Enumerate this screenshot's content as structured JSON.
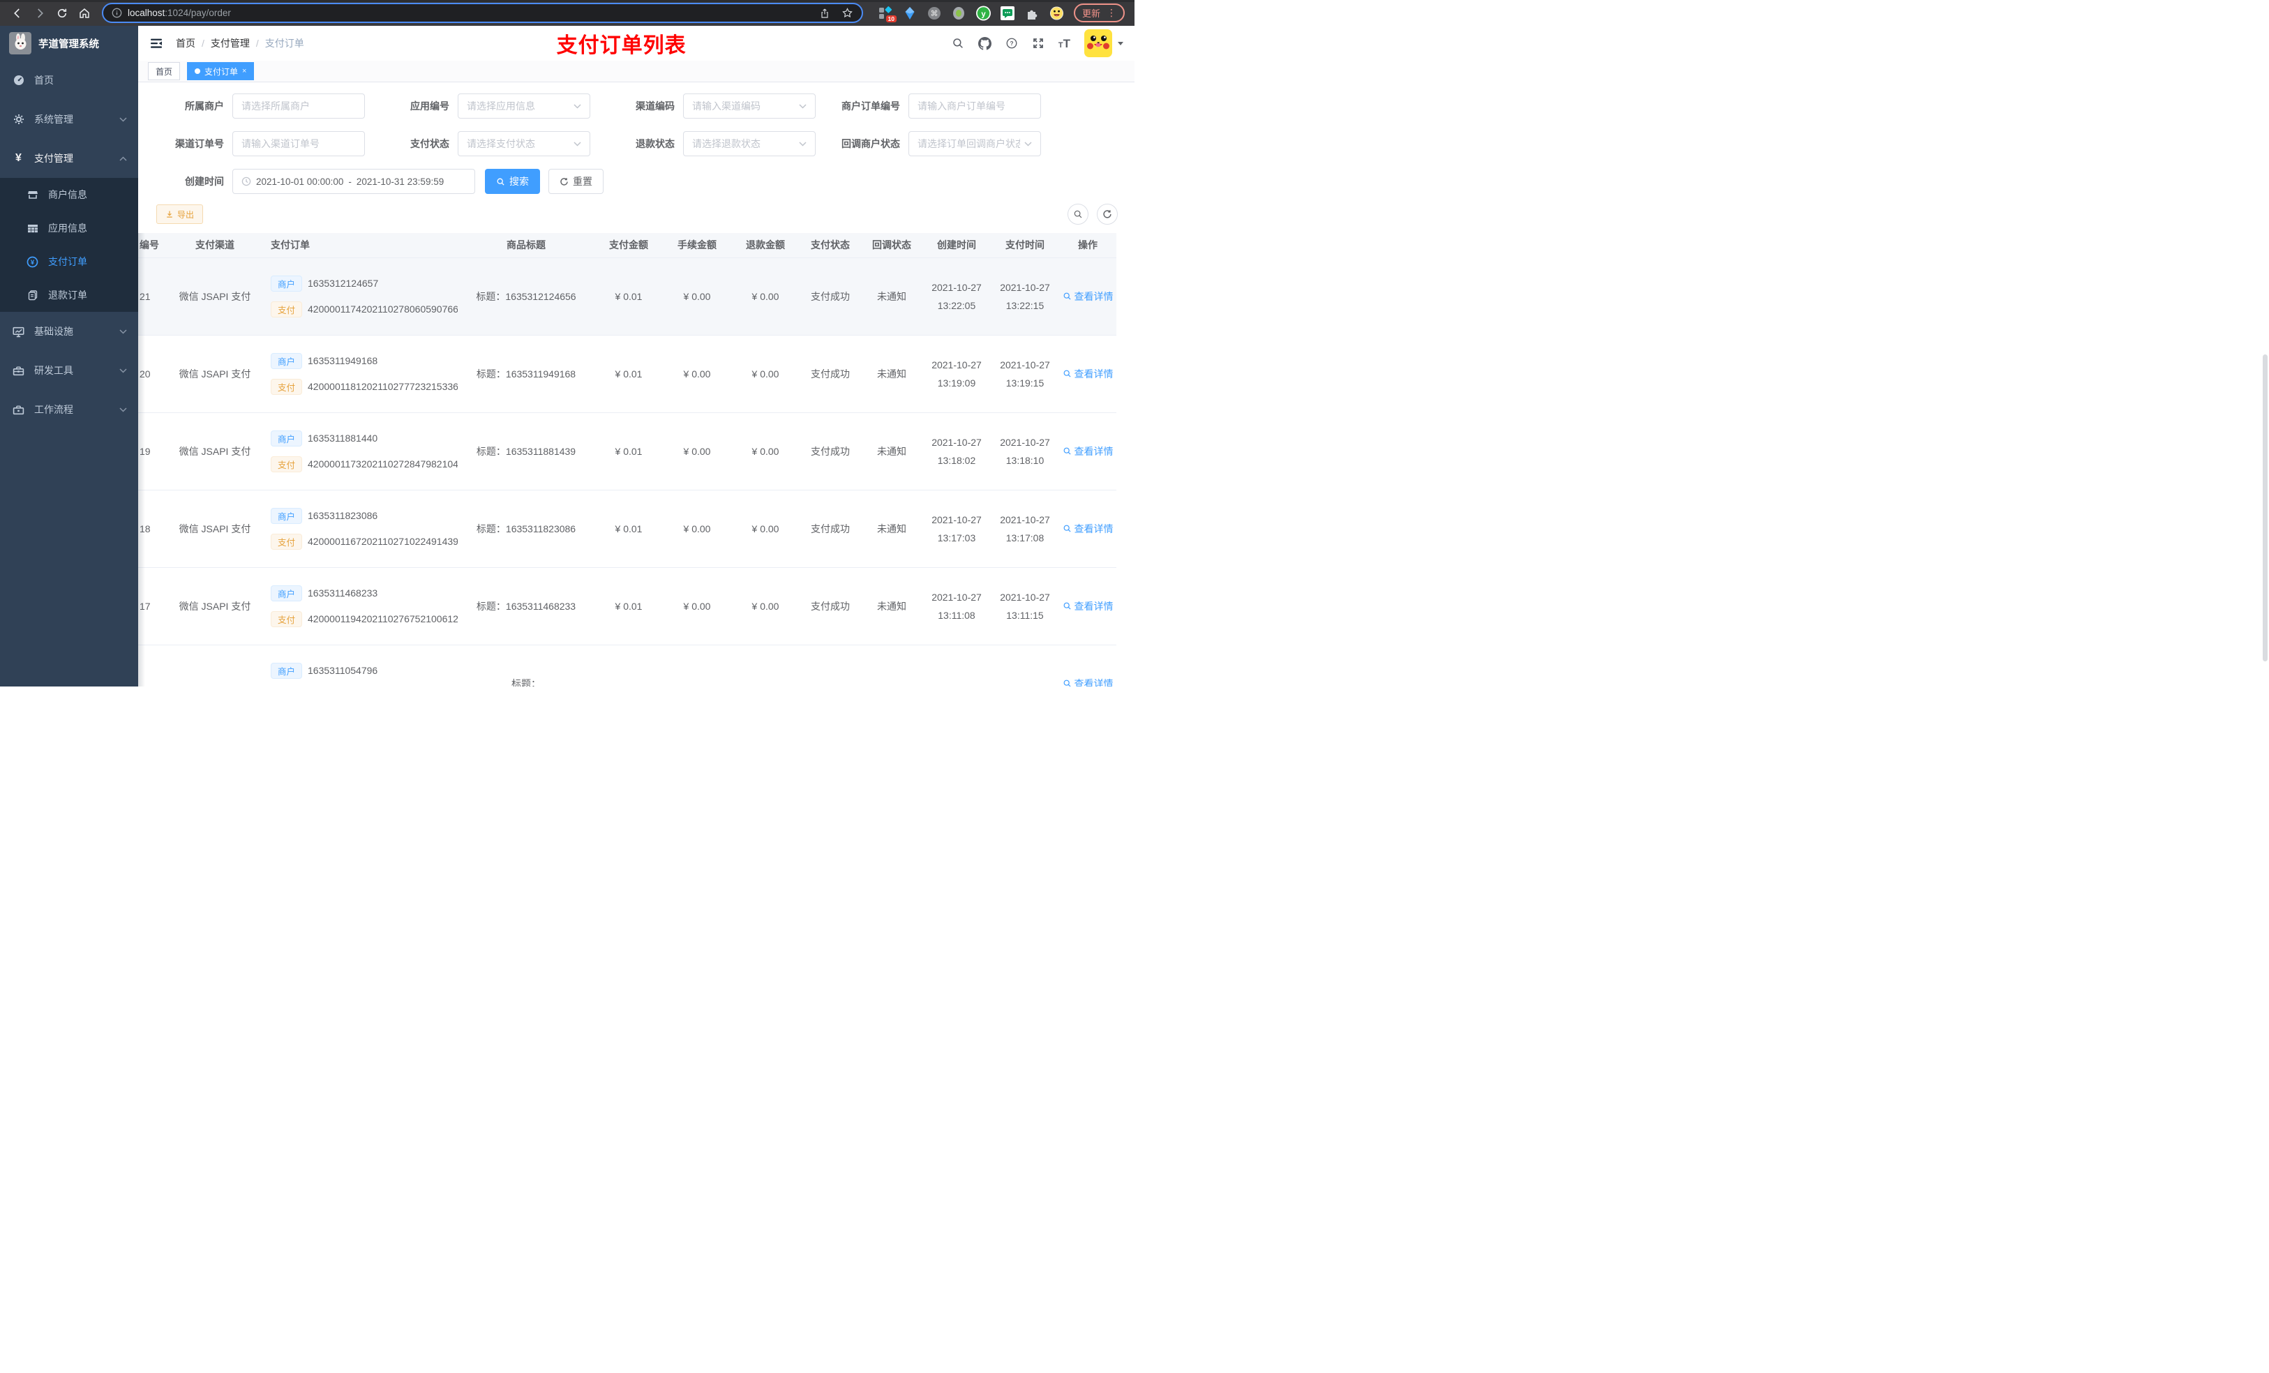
{
  "colors": {
    "accent": "#409eff",
    "title_red": "#ff0000",
    "warning": "#e6a23c",
    "sidebar_bg": "#304156",
    "submenu_bg": "#1f2d3d"
  },
  "browser": {
    "url_host": "localhost",
    "url_path": ":1024/pay/order",
    "ext_badge": "10",
    "update_label": "更新"
  },
  "sidebar": {
    "logo_title": "芋道管理系统",
    "home": "首页",
    "system": "系统管理",
    "pay": "支付管理",
    "merchant_info": "商户信息",
    "app_info": "应用信息",
    "pay_order": "支付订单",
    "refund_order": "退款订单",
    "infra": "基础设施",
    "devtools": "研发工具",
    "workflow": "工作流程"
  },
  "header": {
    "breadcrumb": [
      "首页",
      "支付管理",
      "支付订单"
    ],
    "page_title": "支付订单列表"
  },
  "tabs": {
    "home": "首页",
    "active": "支付订单",
    "close": "×"
  },
  "filters": {
    "merchant": {
      "label": "所属商户",
      "placeholder": "请选择所属商户"
    },
    "app": {
      "label": "应用编号",
      "placeholder": "请选择应用信息"
    },
    "channel_code": {
      "label": "渠道编码",
      "placeholder": "请输入渠道编码"
    },
    "merchant_order_no": {
      "label": "商户订单编号",
      "placeholder": "请输入商户订单编号"
    },
    "channel_order_no": {
      "label": "渠道订单号",
      "placeholder": "请输入渠道订单号"
    },
    "pay_status": {
      "label": "支付状态",
      "placeholder": "请选择支付状态"
    },
    "refund_status": {
      "label": "退款状态",
      "placeholder": "请选择退款状态"
    },
    "notify_status": {
      "label": "回调商户状态",
      "placeholder": "请选择订单回调商户状态"
    },
    "create_time": {
      "label": "创建时间",
      "start": "2021-10-01 00:00:00",
      "separator": "-",
      "end": "2021-10-31 23:59:59"
    },
    "search_label": "搜索",
    "reset_label": "重置"
  },
  "toolbar": {
    "export_label": "导出"
  },
  "table": {
    "columns": [
      "编号",
      "支付渠道",
      "支付订单",
      "商品标题",
      "支付金额",
      "手续金额",
      "退款金额",
      "支付状态",
      "回调状态",
      "创建时间",
      "支付时间",
      "操作"
    ],
    "tag_merchant": "商户",
    "tag_pay": "支付",
    "title_prefix": "标题：",
    "action_label": "查看详情",
    "rows": [
      {
        "id": "21",
        "channel": "微信 JSAPI 支付",
        "merchant_no": "1635312124657",
        "pay_no": "4200001174202110278060590766",
        "title": "1635312124656",
        "pay_amount": "¥ 0.01",
        "fee_amount": "¥ 0.00",
        "refund_amount": "¥ 0.00",
        "pay_status": "支付成功",
        "notify_status": "未通知",
        "create_date": "2021-10-27",
        "create_clock": "13:22:05",
        "pay_date": "2021-10-27",
        "pay_clock": "13:22:15",
        "state": "hover"
      },
      {
        "id": "20",
        "channel": "微信 JSAPI 支付",
        "merchant_no": "1635311949168",
        "pay_no": "4200001181202110277723215336",
        "title": "1635311949168",
        "pay_amount": "¥ 0.01",
        "fee_amount": "¥ 0.00",
        "refund_amount": "¥ 0.00",
        "pay_status": "支付成功",
        "notify_status": "未通知",
        "create_date": "2021-10-27",
        "create_clock": "13:19:09",
        "pay_date": "2021-10-27",
        "pay_clock": "13:19:15"
      },
      {
        "id": "19",
        "channel": "微信 JSAPI 支付",
        "merchant_no": "1635311881440",
        "pay_no": "4200001173202110272847982104",
        "title": "1635311881439",
        "pay_amount": "¥ 0.01",
        "fee_amount": "¥ 0.00",
        "refund_amount": "¥ 0.00",
        "pay_status": "支付成功",
        "notify_status": "未通知",
        "create_date": "2021-10-27",
        "create_clock": "13:18:02",
        "pay_date": "2021-10-27",
        "pay_clock": "13:18:10"
      },
      {
        "id": "18",
        "channel": "微信 JSAPI 支付",
        "merchant_no": "1635311823086",
        "pay_no": "4200001167202110271022491439",
        "title": "1635311823086",
        "pay_amount": "¥ 0.01",
        "fee_amount": "¥ 0.00",
        "refund_amount": "¥ 0.00",
        "pay_status": "支付成功",
        "notify_status": "未通知",
        "create_date": "2021-10-27",
        "create_clock": "13:17:03",
        "pay_date": "2021-10-27",
        "pay_clock": "13:17:08"
      },
      {
        "id": "17",
        "channel": "微信 JSAPI 支付",
        "merchant_no": "1635311468233",
        "pay_no": "4200001194202110276752100612",
        "title": "1635311468233",
        "pay_amount": "¥ 0.01",
        "fee_amount": "¥ 0.00",
        "refund_amount": "¥ 0.00",
        "pay_status": "支付成功",
        "notify_status": "未通知",
        "create_date": "2021-10-27",
        "create_clock": "13:11:08",
        "pay_date": "2021-10-27",
        "pay_clock": "13:11:15"
      },
      {
        "id": "",
        "channel": "",
        "merchant_no": "1635311054796",
        "pay_no": "",
        "title": "",
        "pay_amount": "",
        "fee_amount": "",
        "refund_amount": "",
        "pay_status": "",
        "notify_status": "",
        "create_date": "",
        "create_clock": "",
        "pay_date": "",
        "pay_clock": "",
        "state": "partial"
      }
    ]
  }
}
